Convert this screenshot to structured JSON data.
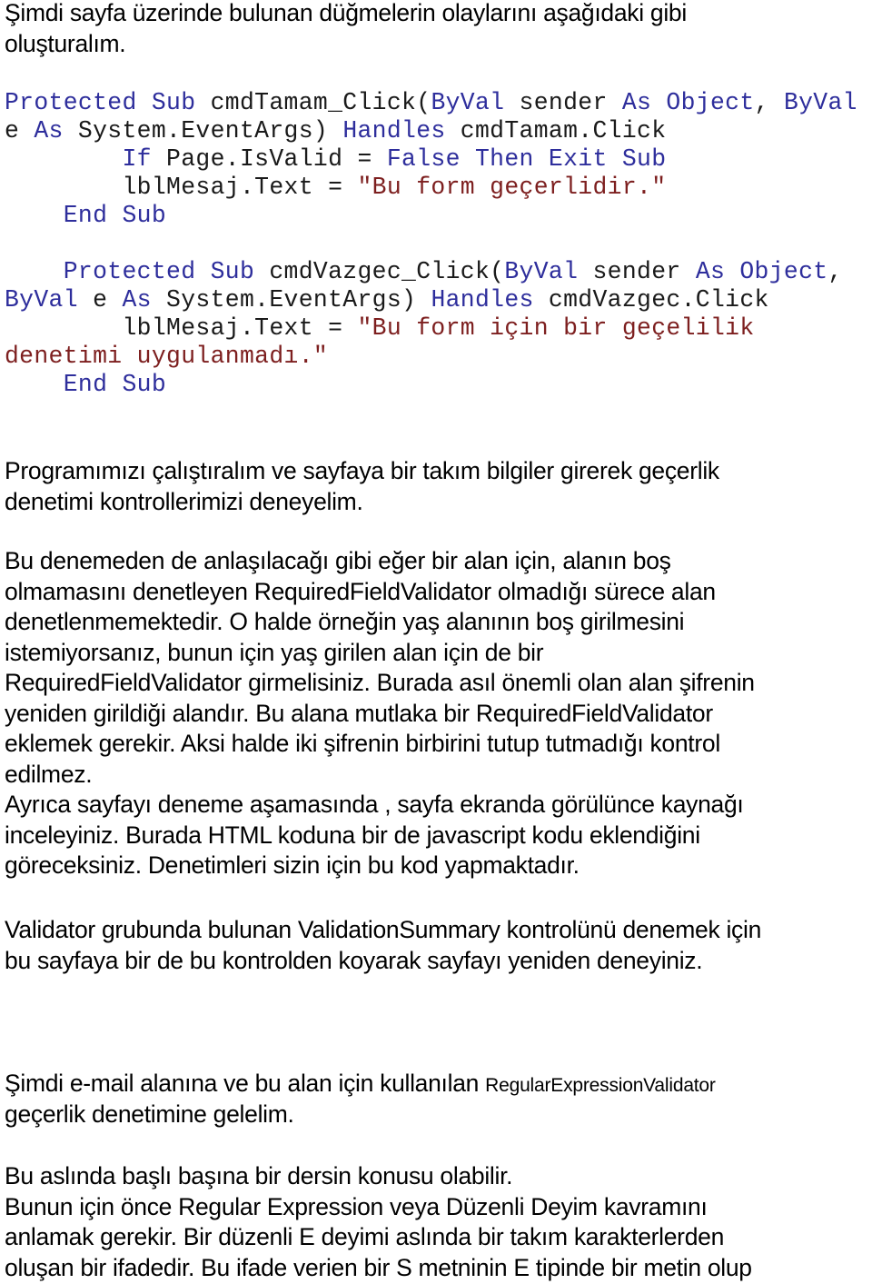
{
  "colors": {
    "keyword": "#2e2e9c",
    "string": "#7d1f1f",
    "plain": "#1a1a1a",
    "text": "#000000"
  },
  "intro": {
    "lines": [
      "Şimdi sayfa üzerinde bulunan düğmelerin olaylarını aşağıdaki gibi",
      "oluşturalım."
    ]
  },
  "code": {
    "lines": [
      [
        {
          "t": "kw",
          "v": "Protected Sub"
        },
        {
          "t": "pl",
          "v": " cmdTamam_Click("
        },
        {
          "t": "kw",
          "v": "ByVal"
        },
        {
          "t": "pl",
          "v": " sender "
        },
        {
          "t": "kw",
          "v": "As Object"
        },
        {
          "t": "pl",
          "v": ", "
        },
        {
          "t": "kw",
          "v": "ByVal"
        }
      ],
      [
        {
          "t": "pl",
          "v": "e "
        },
        {
          "t": "kw",
          "v": "As"
        },
        {
          "t": "pl",
          "v": " System.EventArgs) "
        },
        {
          "t": "kw",
          "v": "Handles"
        },
        {
          "t": "pl",
          "v": " cmdTamam.Click"
        }
      ],
      [
        {
          "t": "pl",
          "v": "        "
        },
        {
          "t": "kw",
          "v": "If"
        },
        {
          "t": "pl",
          "v": " Page.IsValid = "
        },
        {
          "t": "kw",
          "v": "False Then Exit Sub"
        }
      ],
      [
        {
          "t": "pl",
          "v": "        lblMesaj.Text = "
        },
        {
          "t": "str",
          "v": "\"Bu form geçerlidir.\""
        }
      ],
      [
        {
          "t": "pl",
          "v": "    "
        },
        {
          "t": "kw",
          "v": "End Sub"
        }
      ],
      [],
      [
        {
          "t": "pl",
          "v": "    "
        },
        {
          "t": "kw",
          "v": "Protected Sub"
        },
        {
          "t": "pl",
          "v": " cmdVazgec_Click("
        },
        {
          "t": "kw",
          "v": "ByVal"
        },
        {
          "t": "pl",
          "v": " sender "
        },
        {
          "t": "kw",
          "v": "As Object"
        },
        {
          "t": "pl",
          "v": ","
        }
      ],
      [
        {
          "t": "kw",
          "v": "ByVal"
        },
        {
          "t": "pl",
          "v": " e "
        },
        {
          "t": "kw",
          "v": "As"
        },
        {
          "t": "pl",
          "v": " System.EventArgs) "
        },
        {
          "t": "kw",
          "v": "Handles"
        },
        {
          "t": "pl",
          "v": " cmdVazgec.Click"
        }
      ],
      [
        {
          "t": "pl",
          "v": "        lblMesaj.Text = "
        },
        {
          "t": "str",
          "v": "\"Bu form için bir geçelilik"
        }
      ],
      [
        {
          "t": "str",
          "v": "denetimi uygulanmadı.\""
        }
      ],
      [
        {
          "t": "pl",
          "v": "    "
        },
        {
          "t": "kw",
          "v": "End Sub"
        }
      ]
    ]
  },
  "paragraphs": {
    "p1": [
      "Programımızı çalıştıralım ve sayfaya bir takım bilgiler girerek geçerlik",
      "denetimi kontrollerimizi deneyelim."
    ],
    "p2": [
      "Bu denemeden de anlaşılacağı gibi eğer bir alan için, alanın boş",
      "olmamasını denetleyen RequiredFieldValidator olmadığı sürece alan",
      "denetlenmemektedir. O halde örneğin yaş alanının boş girilmesini",
      "istemiyorsanız, bunun için yaş girilen alan için de bir",
      "RequiredFieldValidator girmelisiniz. Burada asıl önemli olan alan şifrenin",
      "yeniden girildiği alandır. Bu alana mutlaka bir RequiredFieldValidator",
      "eklemek gerekir. Aksi halde iki şifrenin birbirini tutup tutmadığı kontrol",
      "edilmez.",
      "Ayrıca sayfayı deneme aşamasında , sayfa ekranda görülünce kaynağı",
      "inceleyiniz. Burada HTML koduna bir de javascript kodu eklendiğini",
      "göreceksiniz. Denetimleri sizin için bu kod yapmaktadır."
    ],
    "p3": [
      "Validator grubunda bulunan ValidationSummary kontrolünü denemek için",
      "bu sayfaya bir de bu kontrolden koyarak sayfayı yeniden deneyiniz."
    ],
    "p4": {
      "line1_main": "Şimdi e-mail alanına ve bu alan için kullanılan ",
      "line1_small": "RegularExpressionValidator",
      "line2": "geçerlik denetimine gelelim."
    },
    "p5": [
      "Bu aslında başlı başına bir dersin konusu olabilir.",
      "Bunun için önce Regular Expression veya Düzenli Deyim kavramını",
      "anlamak gerekir. Bir düzenli E deyimi aslında bir takım karakterlerden",
      "oluşan bir ifadedir. Bu ifade verien bir S metninin E tipinde bir metin olup"
    ]
  }
}
